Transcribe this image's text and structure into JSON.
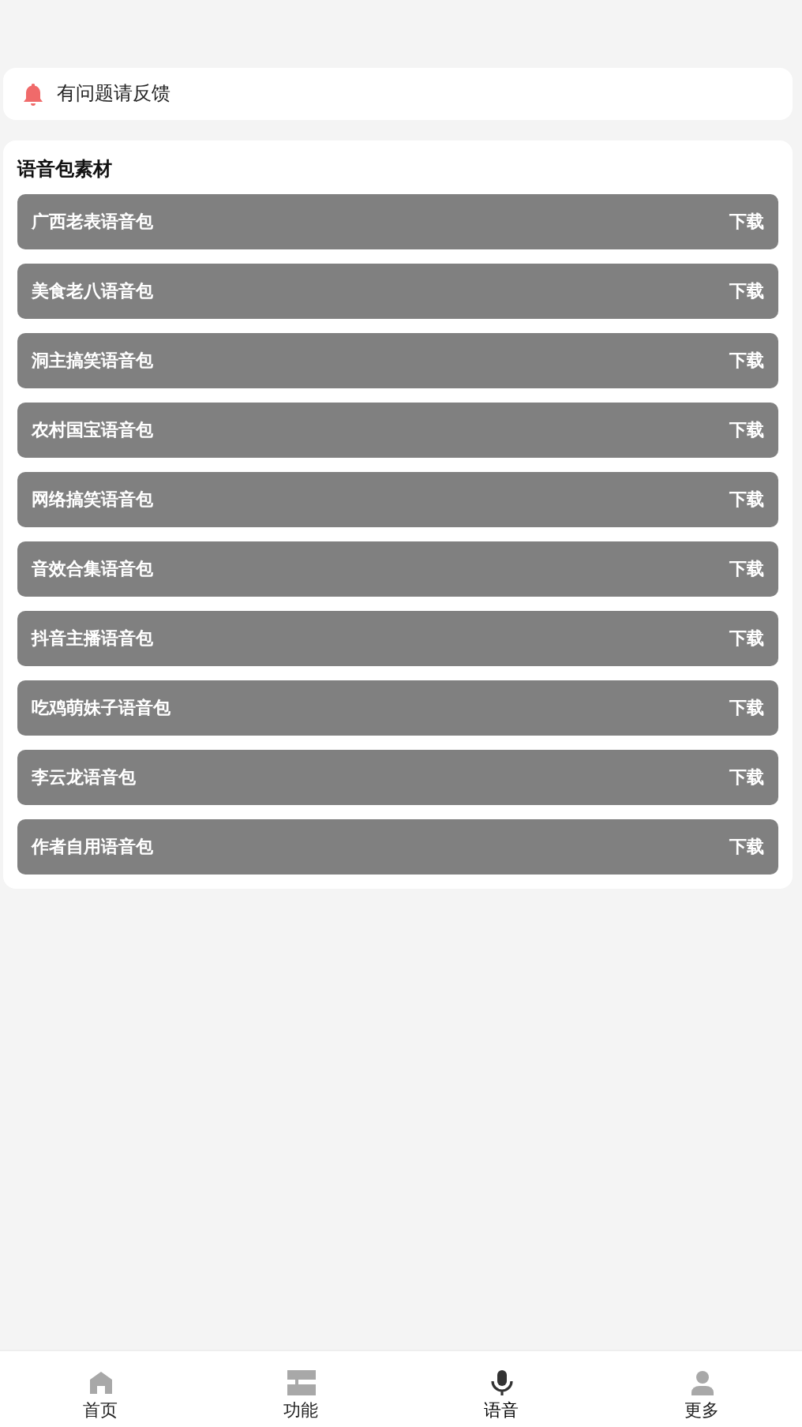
{
  "notice": {
    "text": "有问题请反馈"
  },
  "voice_packs": {
    "title": "语音包素材",
    "items": [
      {
        "name": "广西老表语音包",
        "action": "下载"
      },
      {
        "name": "美食老八语音包",
        "action": "下载"
      },
      {
        "name": "洞主搞笑语音包",
        "action": "下载"
      },
      {
        "name": "农村国宝语音包",
        "action": "下载"
      },
      {
        "name": "网络搞笑语音包",
        "action": "下载"
      },
      {
        "name": "音效合集语音包",
        "action": "下载"
      },
      {
        "name": "抖音主播语音包",
        "action": "下载"
      },
      {
        "name": "吃鸡萌妹子语音包",
        "action": "下载"
      },
      {
        "name": "李云龙语音包",
        "action": "下载"
      },
      {
        "name": "作者自用语音包",
        "action": "下载"
      }
    ]
  },
  "tab_bar": [
    {
      "kind": "home",
      "label": "首页",
      "selected": false
    },
    {
      "kind": "features",
      "label": "功能",
      "selected": false
    },
    {
      "kind": "voice",
      "label": "语音",
      "selected": true
    },
    {
      "kind": "more",
      "label": "更多",
      "selected": false
    }
  ]
}
